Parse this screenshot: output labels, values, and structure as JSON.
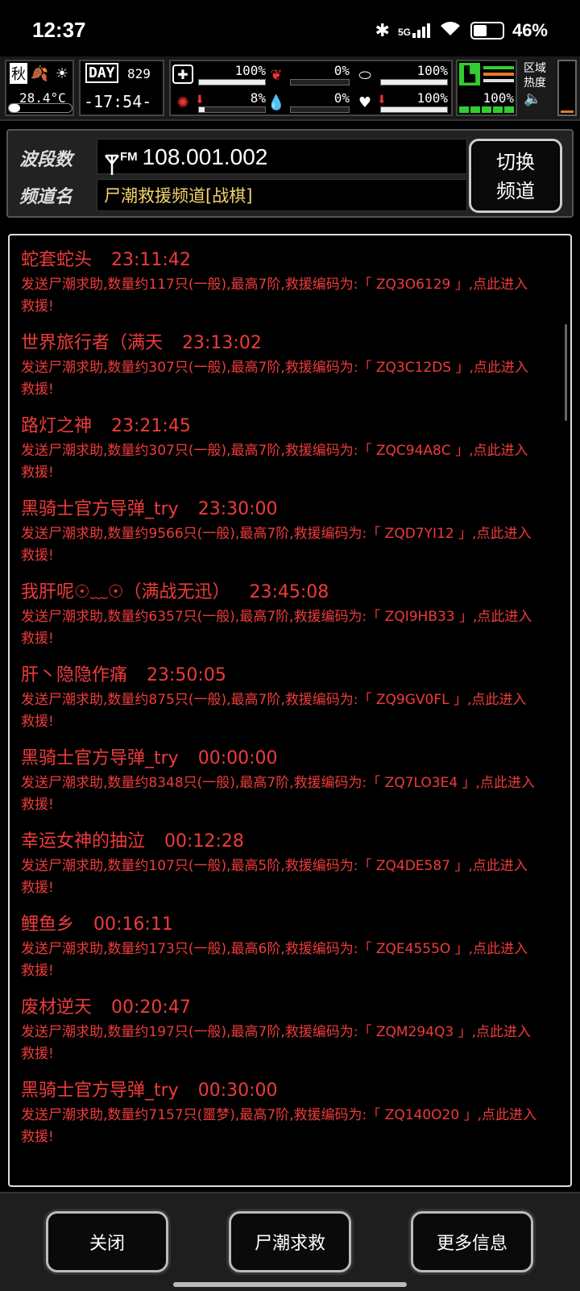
{
  "status_bar": {
    "time": "12:37",
    "network": "5G",
    "battery": "46%",
    "battery_level": 0.46
  },
  "hud": {
    "season": "秋",
    "temperature": "28.4°C",
    "day_label": "DAY",
    "day": "829",
    "clock": "17:54",
    "stats": [
      {
        "name": "health",
        "value": "100%",
        "level": 1.0
      },
      {
        "name": "hunger",
        "value": "0%",
        "level": 0.0
      },
      {
        "name": "capsule",
        "value": "100%",
        "level": 1.0
      },
      {
        "name": "virus",
        "value": "8%",
        "level": 0.08
      },
      {
        "name": "water",
        "value": "0%",
        "level": 0.0
      },
      {
        "name": "heart",
        "value": "100%",
        "level": 1.0
      }
    ],
    "stamina": "100%",
    "stamina_level": 1.0,
    "area_label_1": "区域",
    "area_label_2": "热度"
  },
  "header": {
    "band_label": "波段数",
    "frequency": "108.001.002",
    "channel_label": "频道名",
    "channel_name": "尸潮救援频道[战棋]",
    "switch_line1": "切换",
    "switch_line2": "频道",
    "fm_tag": "FM"
  },
  "messages": [
    {
      "name": "蛇套蛇头",
      "time": "23:11:42",
      "body": "发送尸潮求助,数量约117只(一般),最高7阶,救援编码为:「 ZQ3O6129 」,点此进入救援!"
    },
    {
      "name": "世界旅行者（满天",
      "time": "23:13:02",
      "body": "发送尸潮求助,数量约307只(一般),最高7阶,救援编码为:「 ZQ3C12DS 」,点此进入救援!"
    },
    {
      "name": "路灯之神",
      "time": "23:21:45",
      "body": "发送尸潮求助,数量约307只(一般),最高7阶,救援编码为:「 ZQC94A8C 」,点此进入救援!"
    },
    {
      "name": "黑骑士官方导弹_try",
      "time": "23:30:00",
      "body": "发送尸潮求助,数量约9566只(一般),最高7阶,救援编码为:「 ZQD7YI12 」,点此进入救援!"
    },
    {
      "name": "我肝呢☉﹏☉（满战无迅）",
      "time": "23:45:08",
      "body": "发送尸潮求助,数量约6357只(一般),最高7阶,救援编码为:「 ZQI9HB33 」,点此进入救援!"
    },
    {
      "name": "肝丶隐隐作痛",
      "time": "23:50:05",
      "body": "发送尸潮求助,数量约875只(一般),最高7阶,救援编码为:「 ZQ9GV0FL 」,点此进入救援!"
    },
    {
      "name": "黑骑士官方导弹_try",
      "time": "00:00:00",
      "body": "发送尸潮求助,数量约8348只(一般),最高7阶,救援编码为:「 ZQ7LO3E4 」,点此进入救援!"
    },
    {
      "name": "幸运女神的抽泣",
      "time": "00:12:28",
      "body": "发送尸潮求助,数量约107只(一般),最高5阶,救援编码为:「 ZQ4DE587 」,点此进入救援!"
    },
    {
      "name": "鲤鱼乡",
      "time": "00:16:11",
      "body": "发送尸潮求助,数量约173只(一般),最高6阶,救援编码为:「 ZQE4555O 」,点此进入救援!"
    },
    {
      "name": "废材逆天",
      "time": "00:20:47",
      "body": "发送尸潮求助,数量约197只(一般),最高7阶,救援编码为:「 ZQM294Q3 」,点此进入救援!"
    },
    {
      "name": "黑骑士官方导弹_try",
      "time": "00:30:00",
      "body": "发送尸潮求助,数量约7157只(噩梦),最高7阶,救援编码为:「 ZQ140O20 」,点此进入救援!"
    }
  ],
  "footer": {
    "close": "关闭",
    "zombie_help": "尸潮求救",
    "more_info": "更多信息"
  }
}
